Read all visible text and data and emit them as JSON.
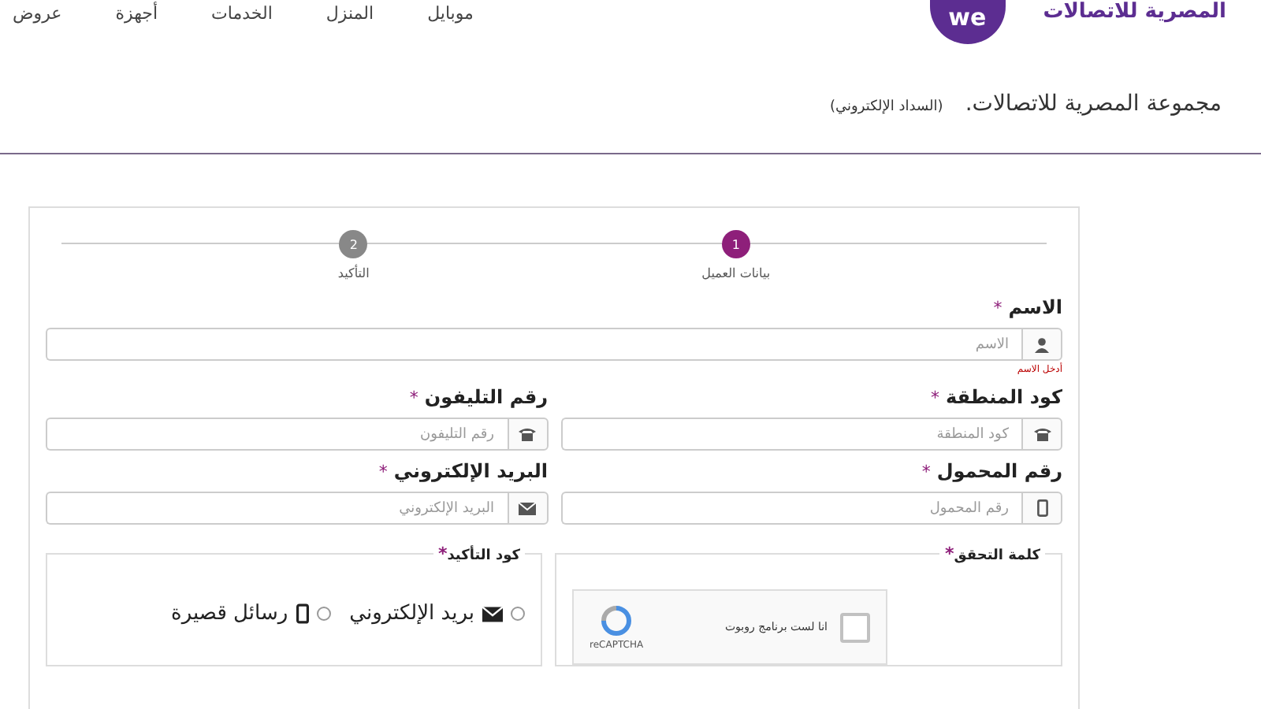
{
  "header": {
    "logo_mark": "we",
    "brand": "المصرية للاتصالات",
    "nav": [
      "موبايل",
      "المنزل",
      "الخدمات",
      "أجهزة",
      "عروض"
    ]
  },
  "breadcrumb": {
    "title": "مجموعة المصرية للاتصالات.",
    "subtitle": "(السداد الإلكتروني)"
  },
  "steps": [
    {
      "number": "1",
      "label": "بيانات العميل",
      "selected": true
    },
    {
      "number": "2",
      "label": "التأكيد",
      "selected": false
    }
  ],
  "fields": [
    {
      "label": "الاسم",
      "required": "*",
      "placeholder": "الاسم",
      "kind": "person",
      "error": "أدخل الاسم"
    },
    {
      "label": "كود المنطقة",
      "required": "*",
      "placeholder": "كود المنطقة",
      "kind": "landline"
    },
    {
      "label": "رقم التليفون",
      "required": "*",
      "placeholder": "رقم التليفون",
      "kind": "landline"
    },
    {
      "label": "رقم المحمول",
      "required": "*",
      "placeholder": "رقم المحمول",
      "kind": "mobile"
    },
    {
      "label": "البريد الإلكتروني",
      "required": "*",
      "placeholder": "البريد الإلكتروني",
      "kind": "email"
    }
  ],
  "captcha": {
    "legend": "كلمة التحقق",
    "required": "*",
    "checkbox_label": "انا لست برنامج روبوت",
    "checked": false,
    "brand": "reCAPTCHA"
  },
  "code": {
    "legend": "كود التأكيد",
    "required": "*",
    "options": [
      {
        "label": "بريد الإلكتروني",
        "kind": "email",
        "selected": false
      },
      {
        "label": "رسائل قصيرة",
        "kind": "sms",
        "selected": false
      }
    ]
  }
}
